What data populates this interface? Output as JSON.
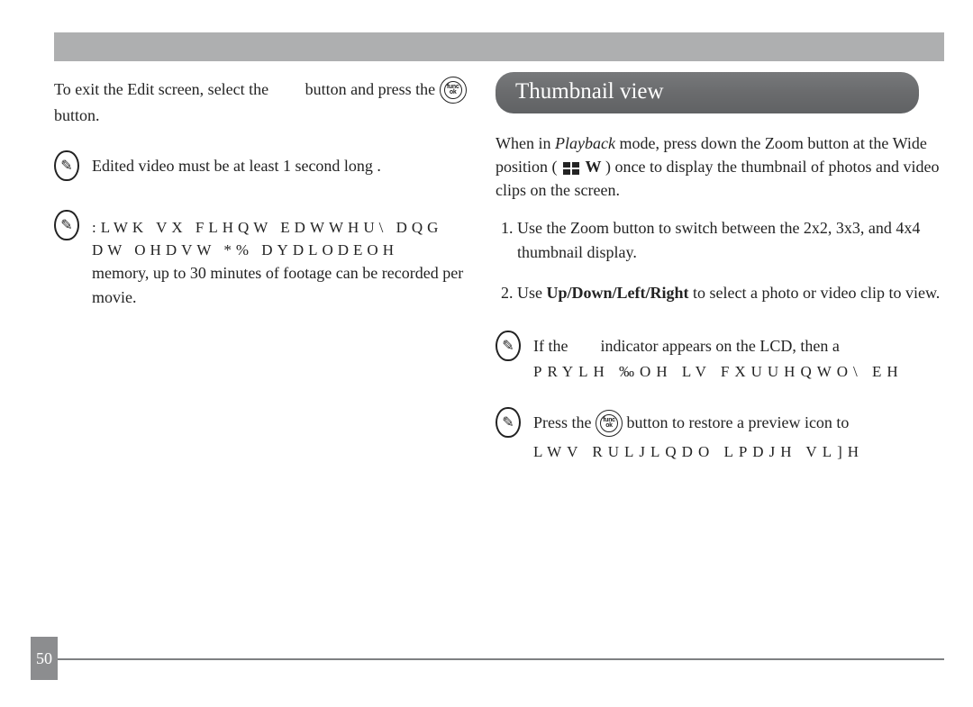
{
  "page_number": "50",
  "left": {
    "exit_a": "To exit the Edit screen, select the ",
    "exit_b": " button and press the ",
    "exit_c": " button.",
    "note1": "Edited video must be at least 1 second long .",
    "note2_a": ":LWK VX FLHQW EDWWHU\\ DQG DW OHDVW *% DYDLODEOH",
    "note2_b": "memory, up to 30 minutes of footage can be recorded per movie."
  },
  "right": {
    "heading": "Thumbnail view",
    "intro_a": "When in ",
    "intro_playback": "Playback",
    "intro_b": " mode, press down the Zoom button at the Wide position ( ",
    "intro_w": "W",
    "intro_c": " ) once to display the thumbnail of photos and video clips on the screen.",
    "step1": "Use the Zoom button to switch between the 2x2, 3x3, and 4x4 thumbnail display.",
    "step2_a": "Use ",
    "step2_dir": "Up/Down/Left/Right",
    "step2_b": " to select a photo or video clip to view.",
    "note3_a": "If the ",
    "note3_b": " indicator appears on the LCD, then a",
    "note3_garbled": "PRYLH ‰OH LV FXUUHQWO\\ EH",
    "note4_a": "Press the ",
    "note4_b": " button to restore a preview icon to",
    "note4_garbled": "LWV RULJLQDO LPDJH VL]H"
  }
}
